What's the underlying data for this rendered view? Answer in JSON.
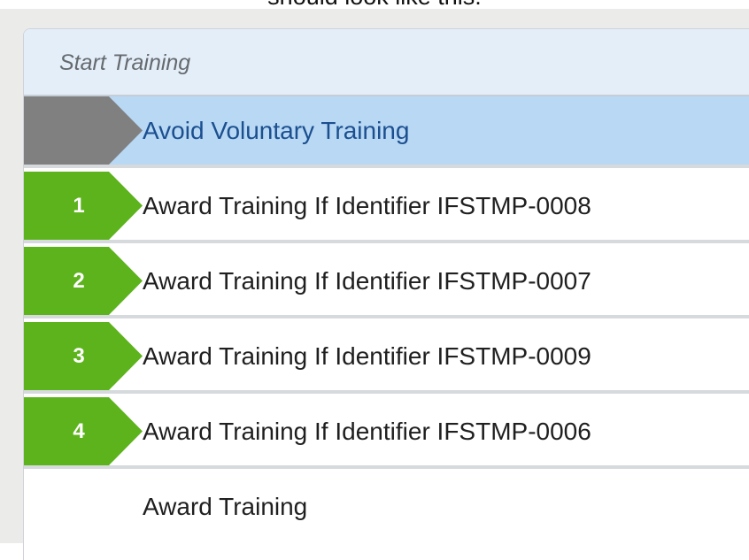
{
  "caption": "should look like this:",
  "panel": {
    "header_title": "Start Training"
  },
  "colors": {
    "marker_selected": "#808080",
    "marker_numbered": "#5cb31b",
    "row_selected_bg": "#b8d8f4",
    "header_bg": "#e3eef9"
  },
  "rows": [
    {
      "number": "",
      "label": "Avoid Voluntary Training",
      "state": "selected"
    },
    {
      "number": "1",
      "label": "Award Training If Identifier IFSTMP-0008",
      "state": "numbered"
    },
    {
      "number": "2",
      "label": "Award Training If Identifier IFSTMP-0007",
      "state": "numbered"
    },
    {
      "number": "3",
      "label": "Award Training If Identifier IFSTMP-0009",
      "state": "numbered"
    },
    {
      "number": "4",
      "label": "Award Training If Identifier IFSTMP-0006",
      "state": "numbered"
    },
    {
      "number": "",
      "label": "Award Training",
      "state": "plain"
    }
  ]
}
